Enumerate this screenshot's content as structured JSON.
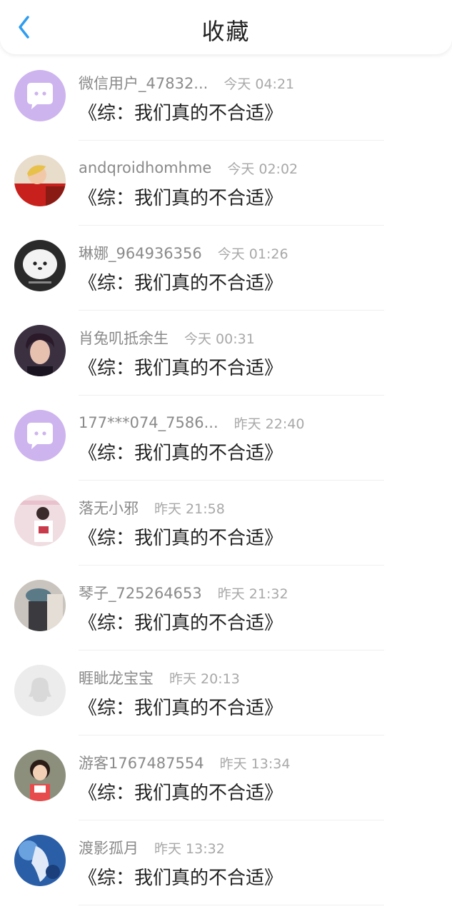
{
  "header": {
    "title": "收藏",
    "back_icon": "chevron-left-icon",
    "accent": "#2f9df0"
  },
  "items": [
    {
      "username": "微信用户_47832...",
      "time": "今天 04:21",
      "book": "《综：我们真的不合适》",
      "avatar": "wechat-default"
    },
    {
      "username": "andqroidhomhme",
      "time": "今天 02:02",
      "book": "《综：我们真的不合适》",
      "avatar": "photo-girl-red"
    },
    {
      "username": "琳娜_964936356",
      "time": "今天 01:26",
      "book": "《综：我们真的不合适》",
      "avatar": "photo-white-dog"
    },
    {
      "username": "肖兔叽抵余生",
      "time": "今天 00:31",
      "book": "《综：我们真的不合适》",
      "avatar": "photo-man-dark"
    },
    {
      "username": "177***074_7586...",
      "time": "昨天 22:40",
      "book": "《综：我们真的不合适》",
      "avatar": "wechat-default"
    },
    {
      "username": "落无小邪",
      "time": "昨天 21:58",
      "book": "《综：我们真的不合适》",
      "avatar": "photo-pink"
    },
    {
      "username": "琴子_725264653",
      "time": "昨天 21:32",
      "book": "《综：我们真的不合适》",
      "avatar": "photo-hat"
    },
    {
      "username": "睚眦龙宝宝",
      "time": "昨天 20:13",
      "book": "《综：我们真的不合适》",
      "avatar": "qq-default"
    },
    {
      "username": "游客1767487554",
      "time": "昨天 13:34",
      "book": "《综：我们真的不合适》",
      "avatar": "photo-child"
    },
    {
      "username": "渡影孤月",
      "time": "昨天 13:32",
      "book": "《综：我们真的不合适》",
      "avatar": "photo-blue-art"
    }
  ]
}
